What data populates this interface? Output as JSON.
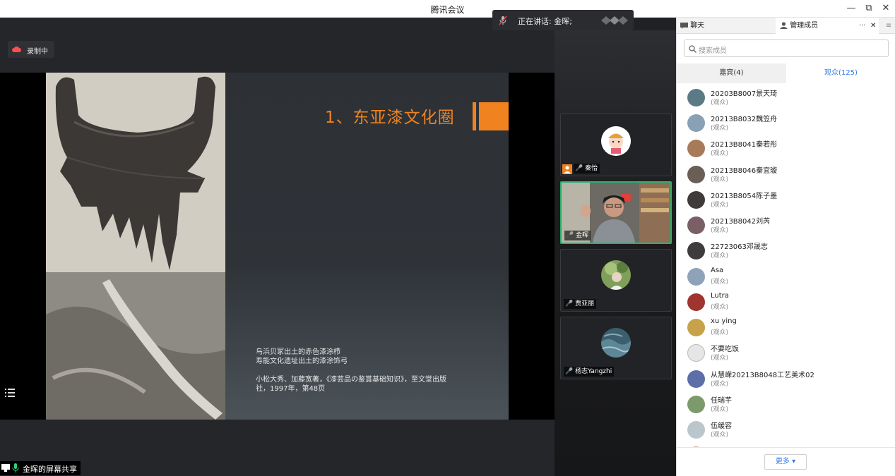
{
  "window": {
    "title": "腾讯会议",
    "minimize": "—",
    "restore": "⧉",
    "close": "✕"
  },
  "speaking": {
    "label": "正在讲话: 金晖;"
  },
  "recording": {
    "label": "录制中"
  },
  "slide": {
    "title": "1、东亚漆文化圈",
    "caption_line1": "鸟浜贝冢出土的赤色漆涂栉",
    "caption_line2": "寿能文化遗址出土的漆涂饰弓",
    "caption_line3": "小松大秀、加藤宽著，《漆芸品の鉴賞基础知识》，至文堂出版",
    "caption_line4": "社，1997年，第48页"
  },
  "screen_share": {
    "label": "金晖的屏幕共享"
  },
  "video_tiles": [
    {
      "name": "秦怡"
    },
    {
      "name": "金晖"
    },
    {
      "name": "贾亚丽"
    },
    {
      "name": "杨志Yangzhi"
    }
  ],
  "panel": {
    "tab_chat": "聊天",
    "tab_members": "管理成员",
    "tab_more": "···",
    "tab_close": "✕",
    "tab_menu": "≡",
    "search_placeholder": "搜索成员",
    "guests_tab": "嘉宾(4)",
    "audience_tab": "观众(125)",
    "more_button": "更多 ▾",
    "members": [
      {
        "name": "20203B8007景天琦",
        "role": "(观众)"
      },
      {
        "name": "20213B8032魏笠舟",
        "role": "(观众)"
      },
      {
        "name": "20213B8041秦若彤",
        "role": "(观众)"
      },
      {
        "name": "20213B8046秦宜璇",
        "role": "(观众)"
      },
      {
        "name": "20213B8054陈子墨",
        "role": "(观众)"
      },
      {
        "name": "20213B8042刘芮",
        "role": "(观众)"
      },
      {
        "name": "22723063邓晟志",
        "role": "(观众)"
      },
      {
        "name": "Asa",
        "role": "(观众)"
      },
      {
        "name": "Lutra",
        "role": "(观众)"
      },
      {
        "name": "xu ying",
        "role": "(观众)"
      },
      {
        "name": "不要吃饭",
        "role": "(观众)"
      },
      {
        "name": "从慧嵘20213B8048工艺美术02",
        "role": "(观众)"
      },
      {
        "name": "任瑞芊",
        "role": "(观众)"
      },
      {
        "name": "伍缓容",
        "role": "(观众)"
      }
    ]
  },
  "colors": {
    "accent_orange": "#f0831f",
    "active_green": "#27b26b",
    "link_blue": "#2f7be6"
  }
}
